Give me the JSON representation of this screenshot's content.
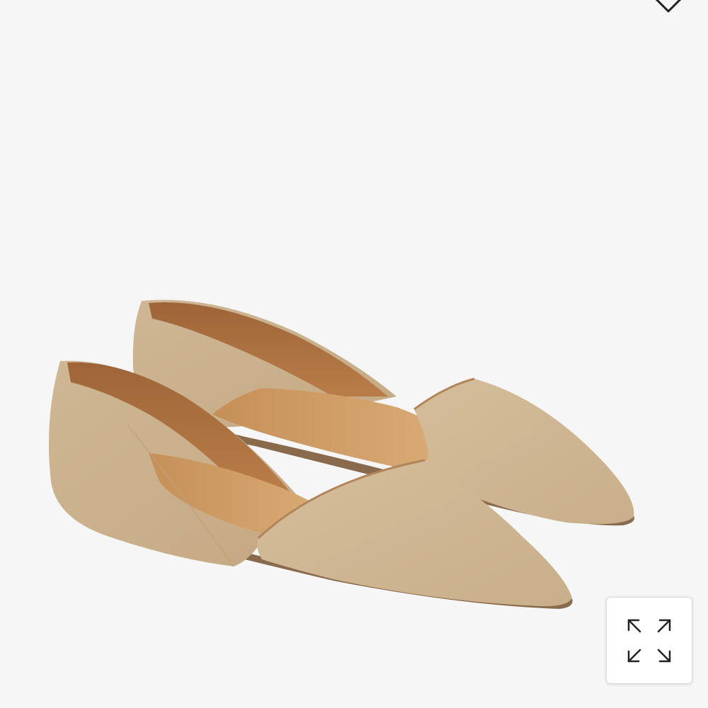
{
  "product_image": {
    "icon": "product-photo-suede-dorsay-flats",
    "colors": {
      "background": "#f6f6f6",
      "suede": "#d0b593",
      "lining": "#a8703f",
      "insole": "#cf9a62",
      "sole": "#8a6a4c"
    }
  },
  "wishlist": {
    "icon": "heart-icon"
  },
  "expand_button": {
    "icon": "expand-arrows-icon"
  }
}
